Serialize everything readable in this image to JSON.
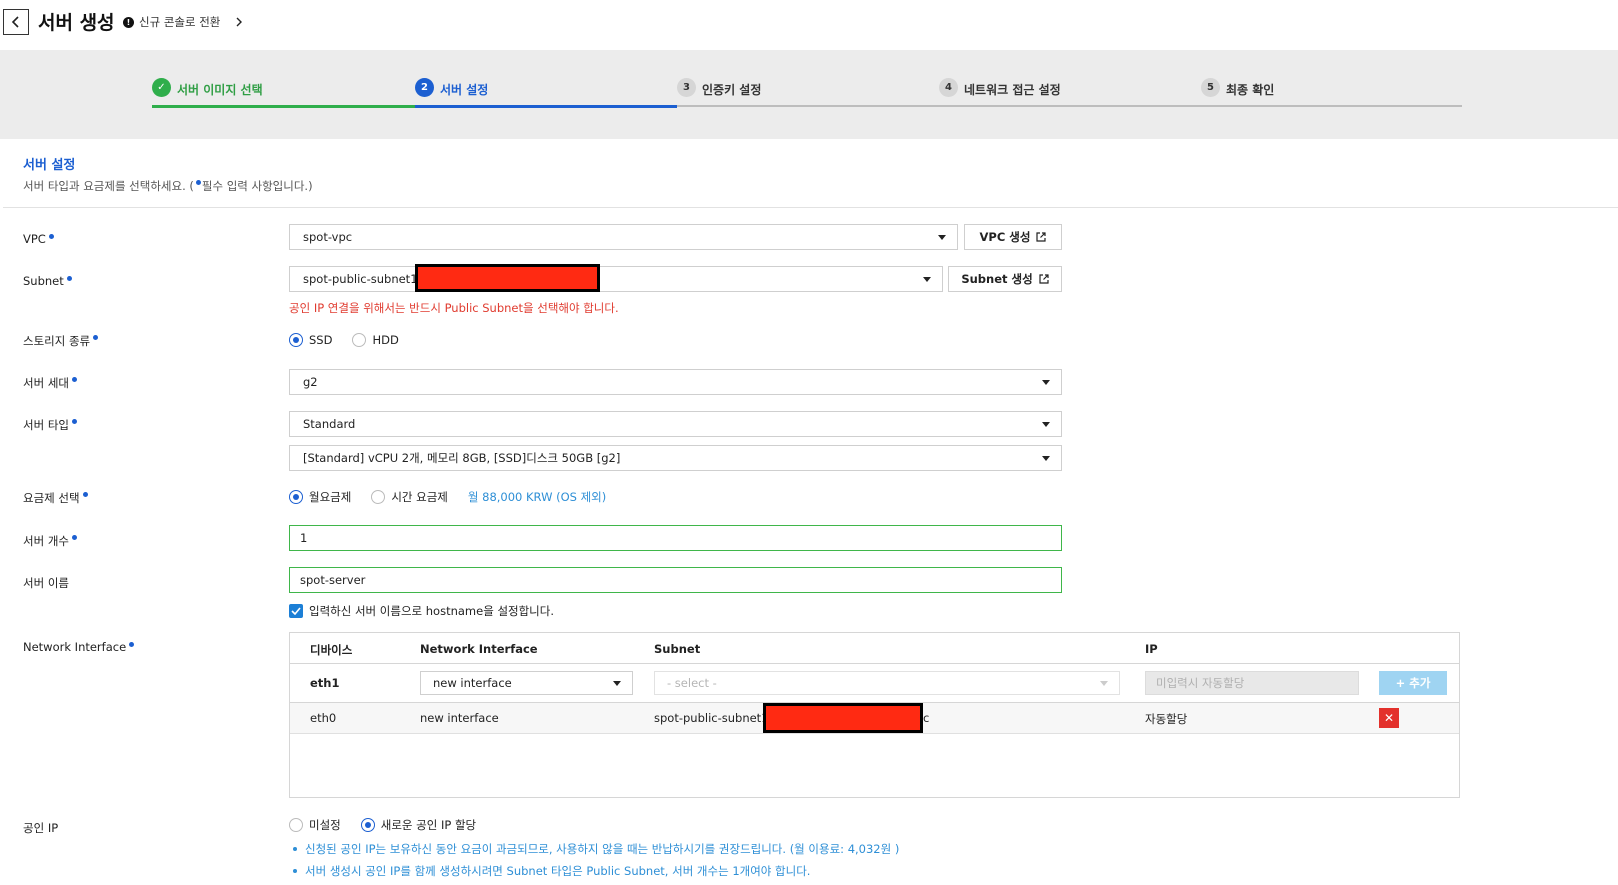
{
  "header": {
    "title": "서버 생성",
    "switch_console": "신규 콘솔로 전환"
  },
  "steps": [
    {
      "num": "✓",
      "label": "서버 이미지 선택",
      "state": "done"
    },
    {
      "num": "2",
      "label": "서버 설정",
      "state": "active"
    },
    {
      "num": "3",
      "label": "인증키 설정",
      "state": "todo"
    },
    {
      "num": "4",
      "label": "네트워크 접근 설정",
      "state": "todo"
    },
    {
      "num": "5",
      "label": "최종 확인",
      "state": "todo"
    }
  ],
  "section": {
    "title": "서버 설정",
    "desc_before": "서버 타입과 요금제를 선택하세요. (",
    "desc_after": "필수 입력 사항입니다.)"
  },
  "form": {
    "vpc": {
      "label": "VPC",
      "value": "spot-vpc",
      "button": "VPC 생성"
    },
    "subnet": {
      "label": "Subnet",
      "value": "spot-public-subnet1 |",
      "button": "Subnet 생성",
      "error": "공인 IP 연결을 위해서는 반드시 Public Subnet을 선택해야 합니다."
    },
    "storage": {
      "label": "스토리지 종류",
      "options": [
        "SSD",
        "HDD"
      ],
      "selected": "SSD"
    },
    "generation": {
      "label": "서버 세대",
      "value": "g2"
    },
    "server_type": {
      "label": "서버 타입",
      "value": "Standard",
      "spec": "[Standard] vCPU 2개, 메모리 8GB, [SSD]디스크 50GB [g2]"
    },
    "pricing": {
      "label": "요금제 선택",
      "options": [
        "월요금제",
        "시간 요금제"
      ],
      "selected": "월요금제",
      "price": "월 88,000 KRW (OS 제외)"
    },
    "count": {
      "label": "서버 개수",
      "value": "1"
    },
    "name": {
      "label": "서버 이름",
      "value": "spot-server",
      "hostname_check": "입력하신 서버 이름으로 hostname을 설정합니다."
    },
    "network_interface": {
      "label": "Network Interface",
      "headers": [
        "디바이스",
        "Network Interface",
        "Subnet",
        "IP"
      ],
      "new_row": {
        "device": "eth1",
        "interface": "new interface",
        "subnet_placeholder": "- select -",
        "ip_placeholder": "미입력시 자동할당",
        "add_button": "+ 추가"
      },
      "rows": [
        {
          "device": "eth0",
          "interface": "new interface",
          "subnet": "spot-public-subnet1",
          "subnet_suffix": "c",
          "ip": "자동할당"
        }
      ]
    },
    "public_ip": {
      "label": "공인 IP",
      "options": [
        "미설정",
        "새로운 공인 IP 할당"
      ],
      "selected": "새로운 공인 IP 할당",
      "notes": [
        "신청된 공인 IP는 보유하신 동안 요금이 과금되므로, 사용하지 않을 때는 반납하시기를 권장드립니다. (월 이용료: 4,032원 )",
        "서버 생성시 공인 IP를 함께 생성하시려면 Subnet 타입은 Public Subnet, 서버 개수는 1개여야 합니다."
      ]
    }
  }
}
